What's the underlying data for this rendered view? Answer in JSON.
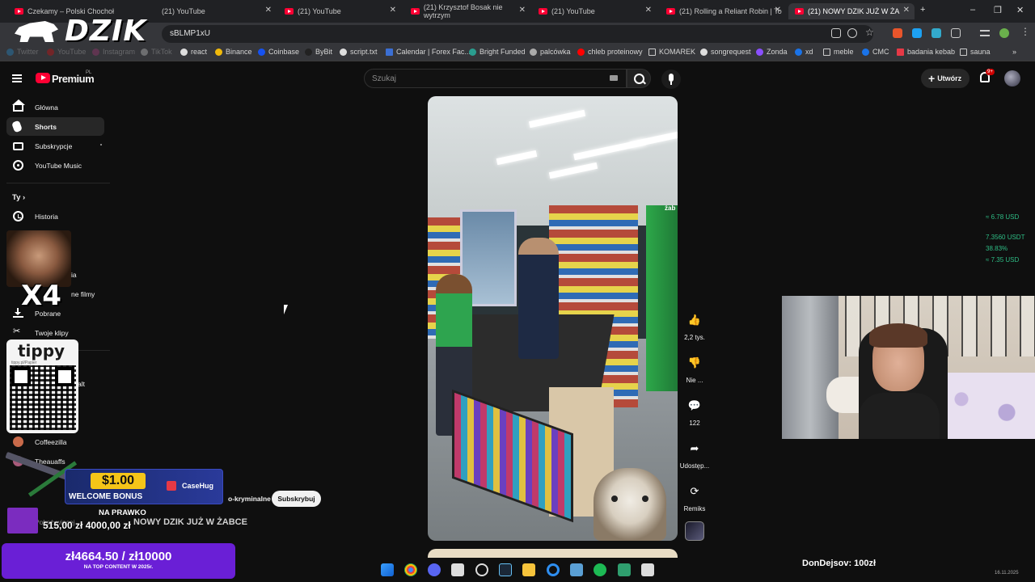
{
  "browser": {
    "tabs": [
      {
        "title": "Czekamy – Polski Chochoł",
        "active": false
      },
      {
        "title": "(21) YouTube",
        "active": false
      },
      {
        "title": "(21) YouTube",
        "active": false
      },
      {
        "title": "(21) Krzysztof Bosak nie wytrzym",
        "active": false
      },
      {
        "title": "(21) YouTube",
        "active": false
      },
      {
        "title": "(21) Rolling a Reliant Robin | To",
        "active": false
      },
      {
        "title": "(21) NOWY DZIK JUŻ W ŻA",
        "active": true
      }
    ],
    "new_tab": "+",
    "window_controls": [
      "–",
      "❐",
      "✕"
    ],
    "url": "sBLMP1xU",
    "bookmarks": [
      "Twitter",
      "YouTube",
      "Instagram",
      "TikTok",
      "react",
      "Binance",
      "Coinbase",
      "ByBit",
      "script.txt",
      "Calendar | Forex Fac...",
      "Bright Funded",
      "palcówka",
      "chleb proteinowy",
      "KOMAREK",
      "songrequest",
      "Zonda",
      "xd",
      "meble",
      "CMC",
      "badania kebab",
      "sauna"
    ],
    "bookmarks_more": "»"
  },
  "overlay_logo": "DZIK",
  "youtube": {
    "brand": "Premium",
    "region": "PL",
    "search_placeholder": "Szukaj",
    "create_label": "Utwórz",
    "notifications_badge": "9+",
    "sidebar": {
      "items": [
        {
          "label": "Główna",
          "icon": "home-icon"
        },
        {
          "label": "Shorts",
          "icon": "shorts-icon",
          "active": true
        },
        {
          "label": "Subskrypcje",
          "icon": "subscriptions-icon"
        },
        {
          "label": "YouTube Music",
          "icon": "youtube-music-icon"
        }
      ],
      "you_section": "Ty",
      "you_chevron": "›",
      "you_items": [
        {
          "label": "Historia",
          "icon": "history-icon"
        },
        {
          "label": "ia",
          "icon": "playlist-icon"
        },
        {
          "label": "ne filmy",
          "icon": "watch-later-icon"
        },
        {
          "label": "Pobrane",
          "icon": "download-icon"
        },
        {
          "label": "Twoje klipy",
          "icon": "scissors-icon"
        }
      ],
      "subscriptions": [
        {
          "label": "alt"
        },
        {
          "label": "Coffeezilla"
        },
        {
          "label": "Theauaffs"
        }
      ],
      "show_more": "Pokaż więcej"
    },
    "short": {
      "title": "NOWY DZIK JUŻ W ŻABCE",
      "channel": "o-kryminalne",
      "subscribe": "Subskrybuj",
      "store_sign": "żab",
      "likes": "2,2 tys.",
      "dislike": "Nie ...",
      "comments": "122",
      "share": "Udostęp...",
      "remix": "Remiks"
    }
  },
  "overlays": {
    "multiplier": "X4",
    "tip_brand": "tippy",
    "tip_url": "tippy.pl/Papier",
    "promo_amount": "$1.00",
    "promo_label": "WELCOME BONUS",
    "promo_brand": "CaseHug",
    "na_prawko": "NA PRAWKO",
    "amounts": "515,00 zł  4000,00 zł",
    "goal_amount": "zł4664.50 / zł10000",
    "goal_sub": "NA TOP CONTENT W 2025r.",
    "donation": "DonDejsov:  100zł"
  },
  "crypto": {
    "price1": "≈ 6.78 USD",
    "price2": "7.3560 USDT",
    "change": "38.83%",
    "price3": "≈ 7.35 USD"
  },
  "taskbar": {
    "date": "16.11.2025"
  },
  "colors": {
    "yt_red": "#ff0033",
    "background": "#0f0f0f",
    "goal_purple": "#6a1fd6",
    "crypto_green": "#2ebd85"
  }
}
